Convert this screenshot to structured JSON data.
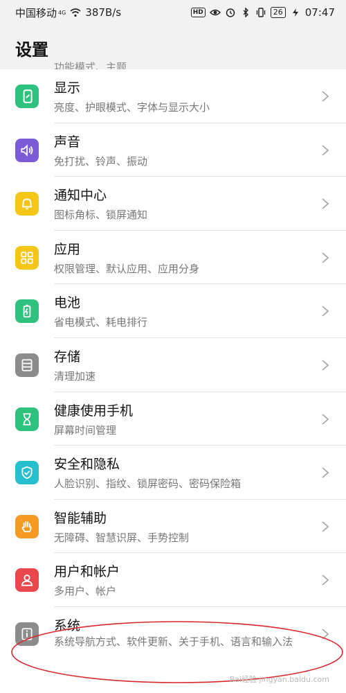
{
  "statusbar": {
    "carrier": "中国移动",
    "net_tag": "4G",
    "speed": "387B/s",
    "hd": "HD",
    "battery": "26",
    "time": "07:47"
  },
  "header": {
    "title": "设置",
    "peek_text": "功能模式、主题"
  },
  "items": [
    {
      "title": "显示",
      "subtitle": "亮度、护眼模式、字体与显示大小",
      "color": "#2ec27e",
      "icon": "phone-display-icon"
    },
    {
      "title": "声音",
      "subtitle": "免打扰、铃声、振动",
      "color": "#7b5cd6",
      "icon": "speaker-icon"
    },
    {
      "title": "通知中心",
      "subtitle": "图标角标、锁屏通知",
      "color": "#f5c518",
      "icon": "bell-icon"
    },
    {
      "title": "应用",
      "subtitle": "权限管理、默认应用、应用分身",
      "color": "#f5c518",
      "icon": "grid-apps-icon"
    },
    {
      "title": "电池",
      "subtitle": "省电模式、耗电排行",
      "color": "#2ec27e",
      "icon": "battery-icon"
    },
    {
      "title": "存储",
      "subtitle": "清理加速",
      "color": "#8c8c8c",
      "icon": "storage-icon"
    },
    {
      "title": "健康使用手机",
      "subtitle": "屏幕时间管理",
      "color": "#2ec27e",
      "icon": "hourglass-icon"
    },
    {
      "title": "安全和隐私",
      "subtitle": "人脸识别、指纹、锁屏密码、密码保险箱",
      "color": "#27bfcf",
      "icon": "shield-check-icon"
    },
    {
      "title": "智能辅助",
      "subtitle": "无障碍、智慧识屏、手势控制",
      "color": "#f59a23",
      "icon": "hand-icon"
    },
    {
      "title": "用户和帐户",
      "subtitle": "多用户、帐户",
      "color": "#e9474c",
      "icon": "user-icon"
    },
    {
      "title": "系统",
      "subtitle": "系统导航方式、软件更新、关于手机、语言和输入法",
      "color": "#8c8c8c",
      "icon": "info-icon"
    }
  ],
  "watermark": "Bai经验 jingyan.baidu.com",
  "highlight_color": "#d9262b"
}
